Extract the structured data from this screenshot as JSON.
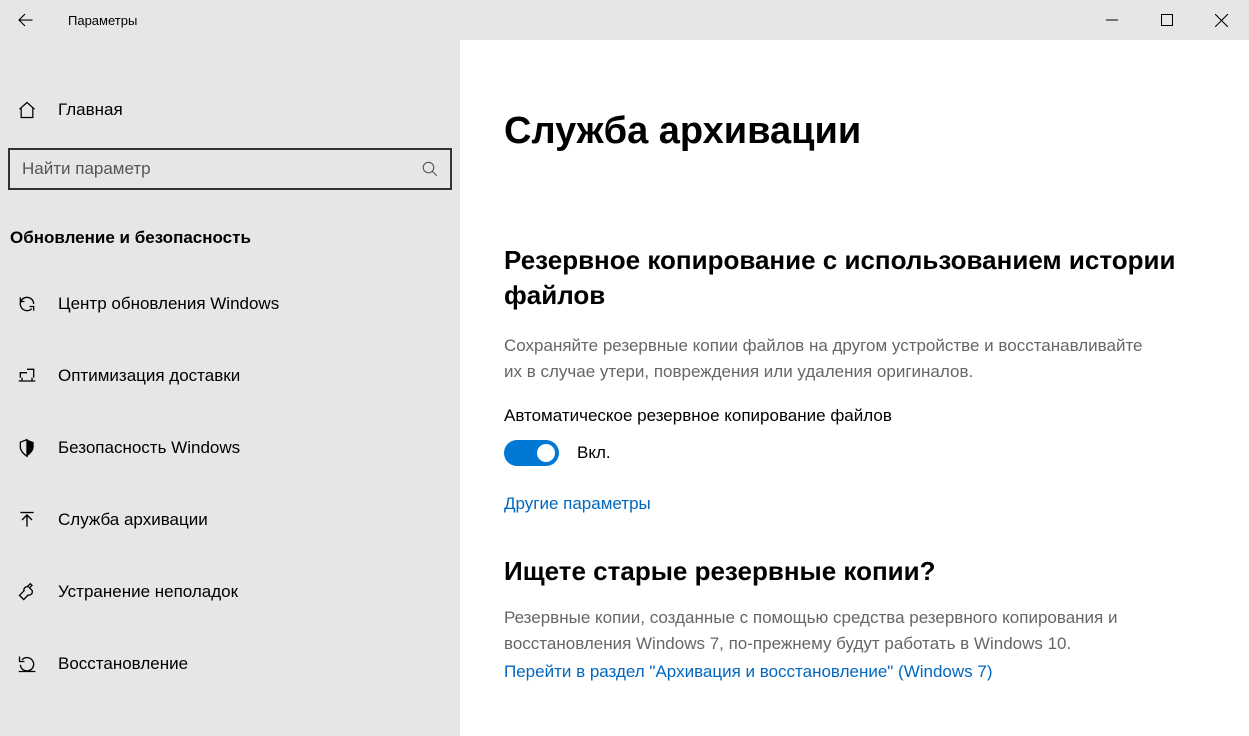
{
  "titlebar": {
    "title": "Параметры"
  },
  "sidebar": {
    "home": "Главная",
    "search_placeholder": "Найти параметр",
    "section": "Обновление и безопасность",
    "items": [
      {
        "label": "Центр обновления Windows"
      },
      {
        "label": "Оптимизация доставки"
      },
      {
        "label": "Безопасность Windows"
      },
      {
        "label": "Служба архивации"
      },
      {
        "label": "Устранение неполадок"
      },
      {
        "label": "Восстановление"
      }
    ]
  },
  "main": {
    "title": "Служба архивации",
    "section1_title": "Резервное копирование с использованием истории файлов",
    "section1_desc": "Сохраняйте резервные копии файлов на другом устройстве и восстанавливайте их в случае утери, повреждения или удаления оригиналов.",
    "toggle_label": "Автоматическое резервное копирование файлов",
    "toggle_state": "Вкл.",
    "link_more": "Другие параметры",
    "section2_title": "Ищете старые резервные копии?",
    "section2_desc": "Резервные копии, созданные с помощью средства резервного копирования и восстановления Windows 7, по-прежнему будут работать в Windows 10.",
    "link_win7": "Перейти в раздел \"Архивация и восстановление\" (Windows 7)"
  }
}
